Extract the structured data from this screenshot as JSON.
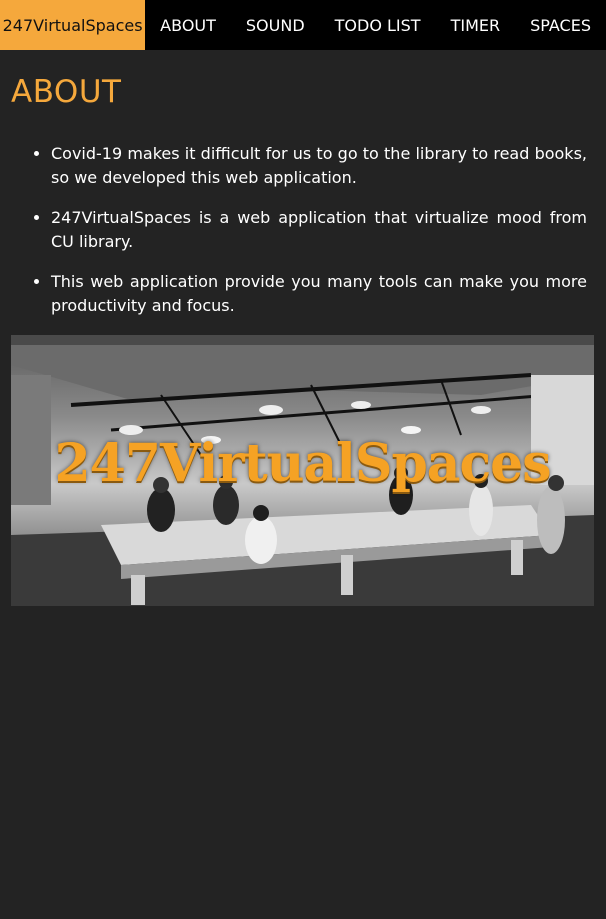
{
  "nav": {
    "brand": "247VirtualSpaces",
    "items": [
      "ABOUT",
      "SOUND",
      "TODO LIST",
      "TIMER",
      "SPACES"
    ]
  },
  "about": {
    "title": "ABOUT",
    "points": [
      "Covid-19 makes it difficult for us to go to the library to read books, so we developed this web application.",
      "247VirtualSpaces is a web application that virtualize mood from CU library.",
      "This web application provide you many tools can make you more productivity and focus."
    ]
  },
  "hero": {
    "overlay_text": "247VirtualSpaces",
    "description": "black-and-white photo of a library study area"
  },
  "colors": {
    "accent": "#f5a83c",
    "background": "#232323",
    "navbar": "#000000"
  }
}
